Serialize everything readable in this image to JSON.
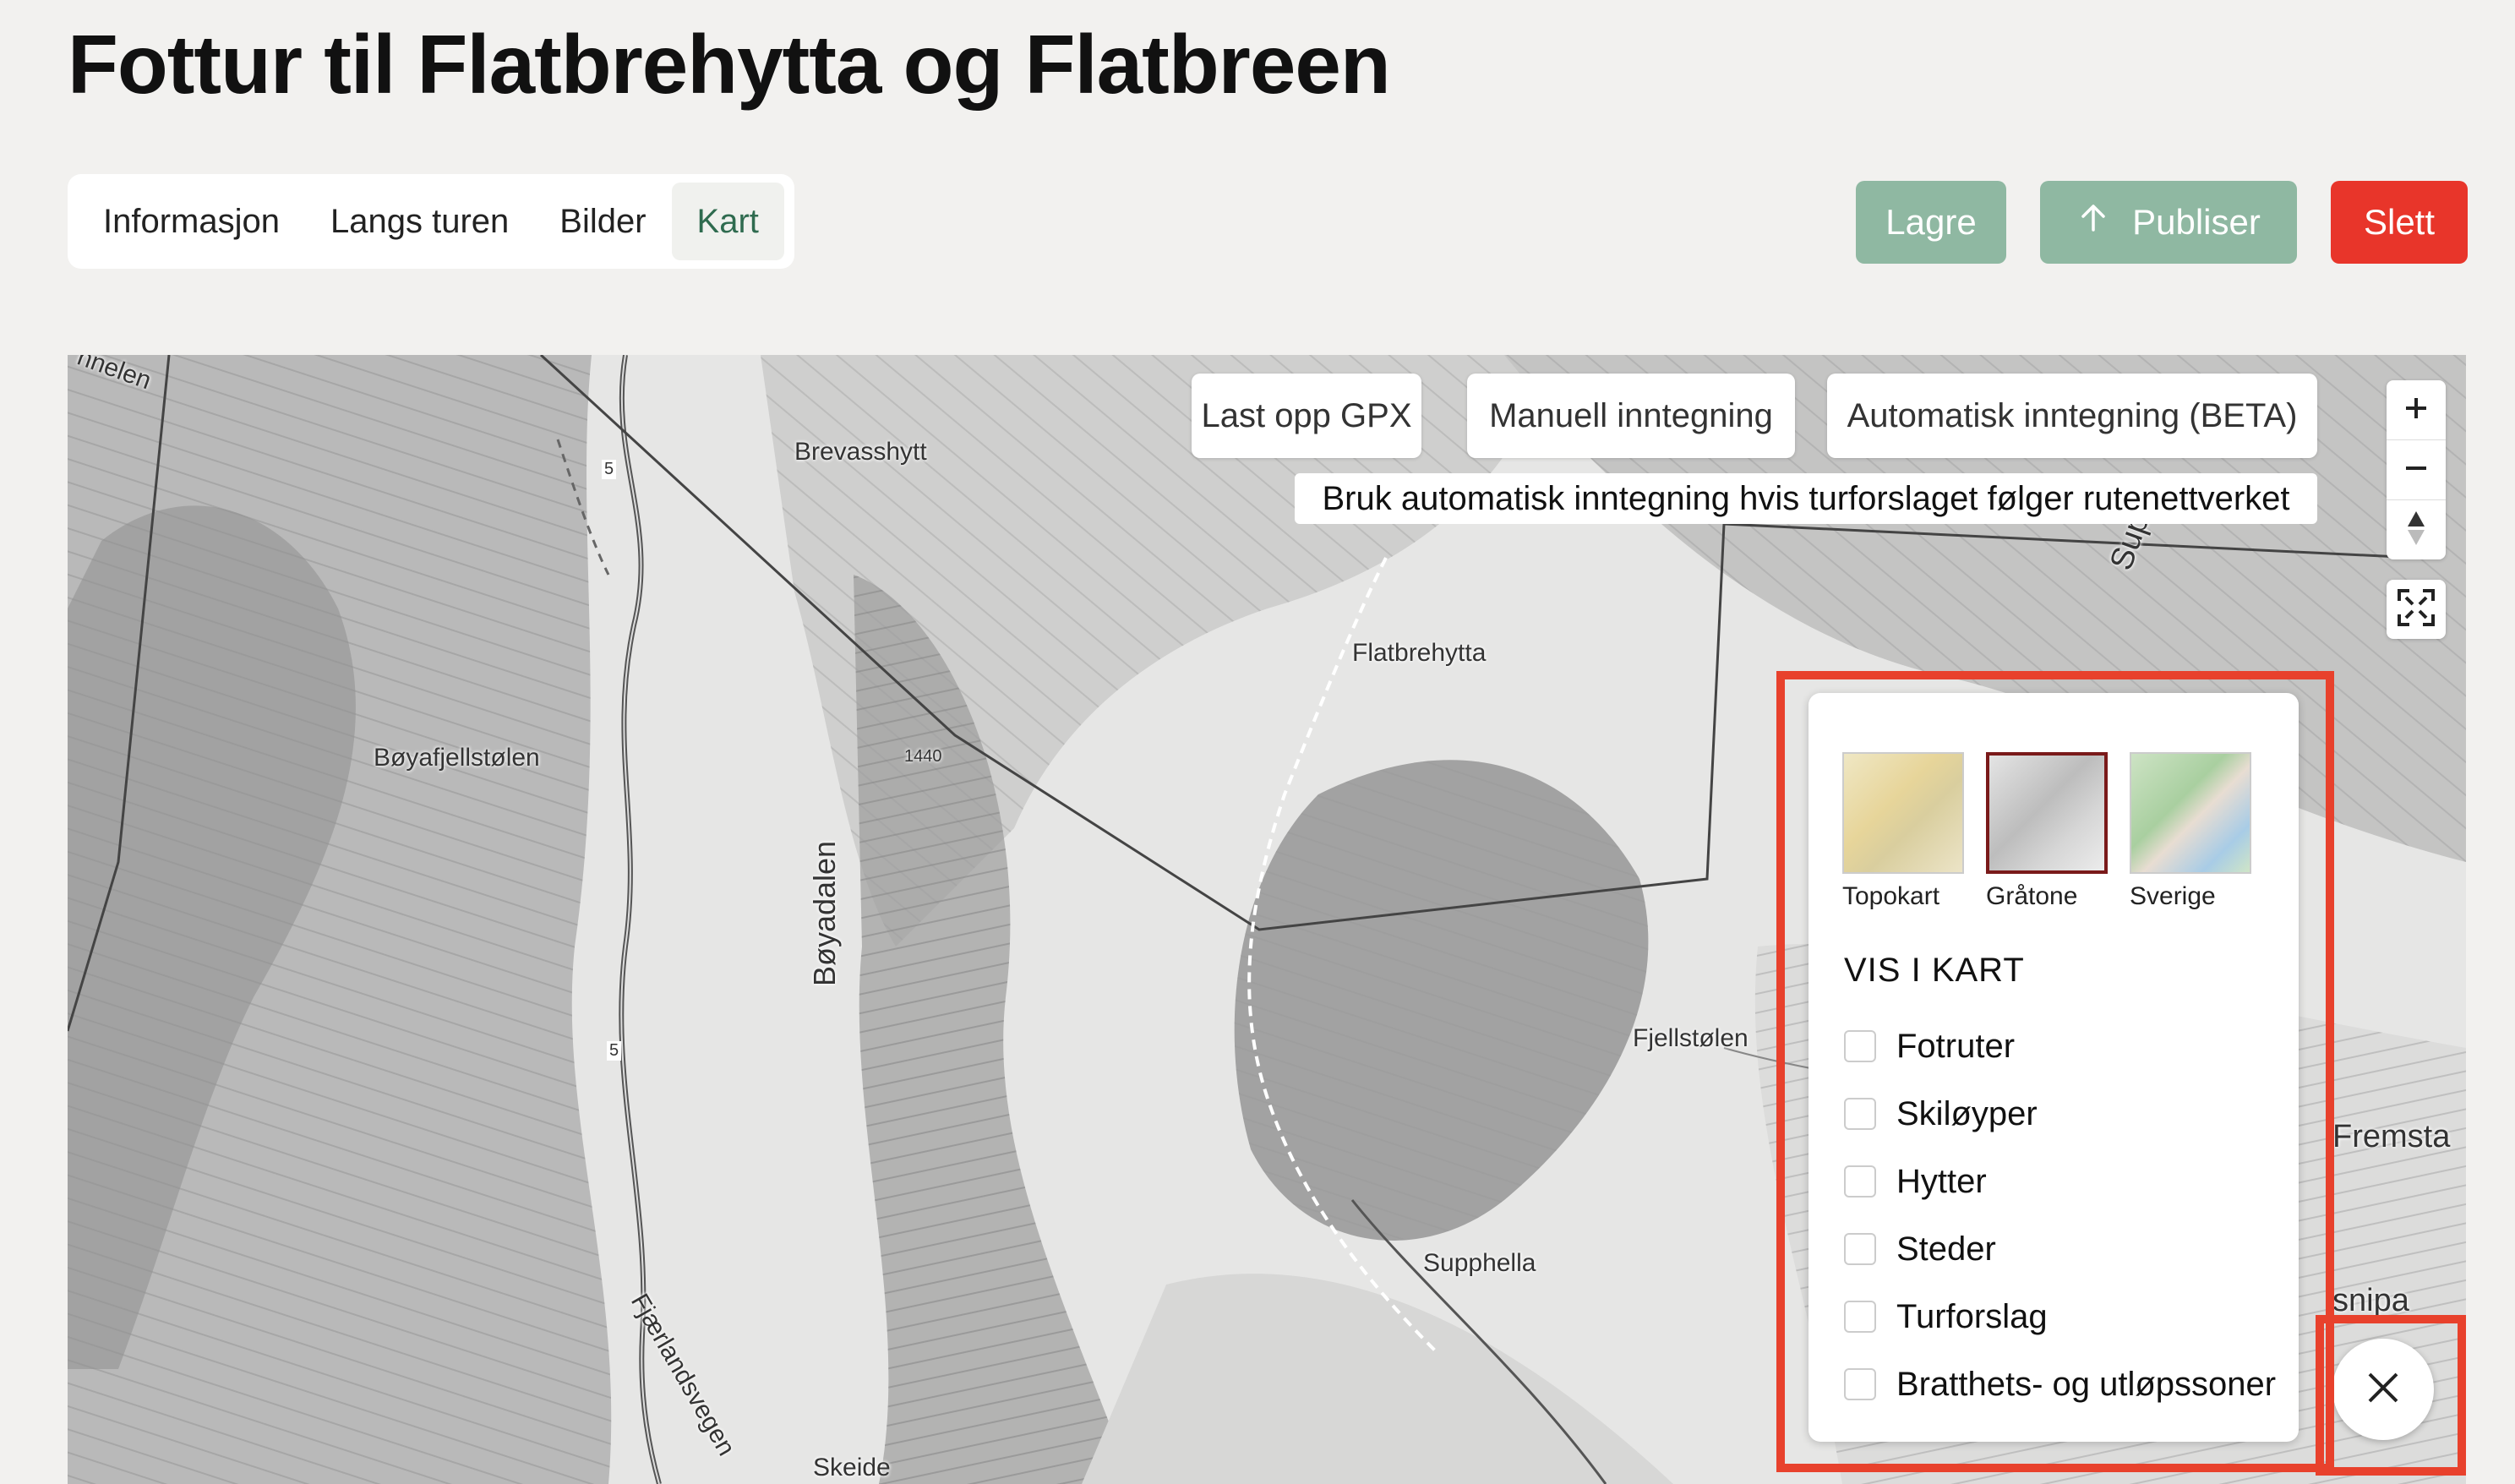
{
  "page": {
    "title": "Fottur til Flatbrehytta og Flatbreen"
  },
  "tabs": [
    {
      "label": "Informasjon",
      "active": false
    },
    {
      "label": "Langs turen",
      "active": false
    },
    {
      "label": "Bilder",
      "active": false
    },
    {
      "label": "Kart",
      "active": true
    }
  ],
  "actions": {
    "save": "Lagre",
    "publish": "Publiser",
    "delete": "Slett"
  },
  "colors": {
    "accent_green": "#8fb8a2",
    "active_tab_text": "#2f6b4f",
    "danger": "#e8352a",
    "highlight": "#e8412c"
  },
  "map": {
    "buttons": {
      "upload_gpx": "Last opp GPX",
      "manual": "Manuell inntegning",
      "automatic": "Automatisk inntegning (BETA)"
    },
    "hint": "Bruk automatisk inntegning hvis turforslaget følger rutenettverket",
    "labels": {
      "brevasshytt": "Brevasshytt",
      "flatbrehytta": "Flatbrehytta",
      "boyafjellstolen": "Bøyafjellstølen",
      "boyadalen": "Bøyadalen",
      "fjellstolen": "Fjellstølen",
      "supphella": "Supphella",
      "fremsta": "Fremsta",
      "fjaerlandsvegen": "Fjærlandsvegen",
      "skeide": "Skeide",
      "elevation": "1440",
      "road_5a": "5",
      "road_5b": "5",
      "nnelen": "nnelen",
      "supp": "Supp",
      "snipa": "snipa"
    },
    "controls": {
      "zoom_in_icon": "plus-icon",
      "zoom_out_icon": "minus-icon",
      "compass_icon": "compass-icon",
      "fullscreen_icon": "fullscreen-icon"
    }
  },
  "layer_panel": {
    "base_maps": [
      {
        "label": "Topokart",
        "selected": false
      },
      {
        "label": "Gråtone",
        "selected": true
      },
      {
        "label": "Sverige",
        "selected": false
      }
    ],
    "section_title": "VIS I KART",
    "layers": [
      {
        "label": "Fotruter",
        "checked": false
      },
      {
        "label": "Skiløyper",
        "checked": false
      },
      {
        "label": "Hytter",
        "checked": false
      },
      {
        "label": "Steder",
        "checked": false
      },
      {
        "label": "Turforslag",
        "checked": false
      },
      {
        "label": "Bratthets- og utløpssoner",
        "checked": false
      }
    ],
    "close_icon": "close-icon"
  }
}
